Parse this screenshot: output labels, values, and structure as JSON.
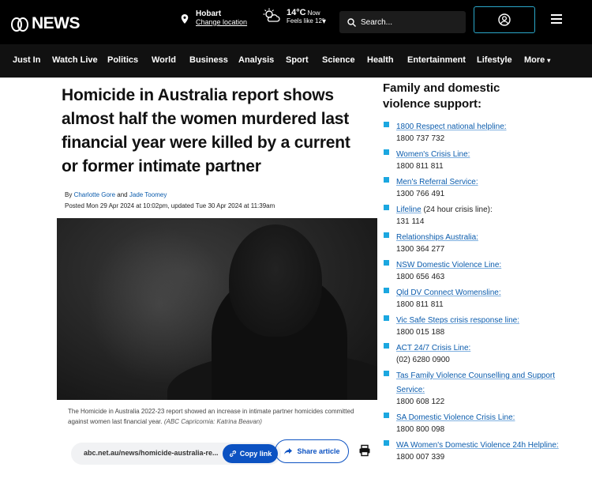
{
  "header": {
    "logo": "NEWS",
    "location": {
      "city": "Hobart",
      "change_label": "Change location"
    },
    "weather": {
      "temp": "14°C",
      "now": "Now",
      "feels_like": "Feels like 12°"
    },
    "search_placeholder": "Search..."
  },
  "nav": {
    "items": [
      "Just In",
      "Watch Live",
      "Politics",
      "World",
      "Business",
      "Analysis",
      "Sport",
      "Science",
      "Health",
      "Entertainment",
      "Lifestyle",
      "More"
    ]
  },
  "article": {
    "headline": "Homicide in Australia report shows almost half the women murdered last financial year were killed by a current or former intimate partner",
    "by_prefix": "By",
    "author1": "Charlotte Gore",
    "and": "and",
    "author2": "Jade Toomey",
    "posted": "Posted Mon 29 Apr 2024 at 10:02pm, updated Tue 30 Apr 2024 at 11:39am",
    "caption_main": "The Homicide in Australia 2022-23 report showed an increase in intimate partner homicides committed against women last financial year.",
    "caption_credit": "(ABC Capricornia: Katrina Beavan)",
    "share": {
      "url": "abc.net.au/news/homicide-australia-re...",
      "copy_label": "Copy link",
      "share_label": "Share article"
    }
  },
  "sidebar": {
    "title": "Family and domestic violence support:",
    "items": [
      {
        "name": "1800 Respect national helpline:",
        "extra": "",
        "phone": "1800 737 732"
      },
      {
        "name": "Women's Crisis Line:",
        "extra": "",
        "phone": "1800 811 811"
      },
      {
        "name": "Men's Referral Service:",
        "extra": "",
        "phone": "1300 766 491"
      },
      {
        "name": "Lifeline",
        "extra": " (24 hour crisis line):",
        "phone": "131 114"
      },
      {
        "name": "Relationships Australia:",
        "extra": "",
        "phone": "1300 364 277"
      },
      {
        "name": "NSW Domestic Violence Line:",
        "extra": "",
        "phone": "1800 656 463"
      },
      {
        "name": "Qld DV Connect Womensline:",
        "extra": "",
        "phone": "1800 811 811"
      },
      {
        "name": "Vic Safe Steps crisis response line:",
        "extra": "",
        "phone": "1800 015 188"
      },
      {
        "name": "ACT 24/7 Crisis Line:",
        "extra": "",
        "phone": "(02) 6280 0900"
      },
      {
        "name": "Tas Family Violence Counselling and Support Service:",
        "extra": "",
        "phone": "1800 608 122"
      },
      {
        "name": "SA Domestic Violence Crisis Line:",
        "extra": "",
        "phone": "1800 800 098"
      },
      {
        "name": "WA Women's Domestic Violence 24h Helpline:",
        "extra": "",
        "phone": "1800 007 339"
      }
    ]
  },
  "colors": {
    "accent": "#0c52c2",
    "link": "#0b5cad",
    "bullet": "#1ba7e0",
    "topbar": "#000000"
  }
}
